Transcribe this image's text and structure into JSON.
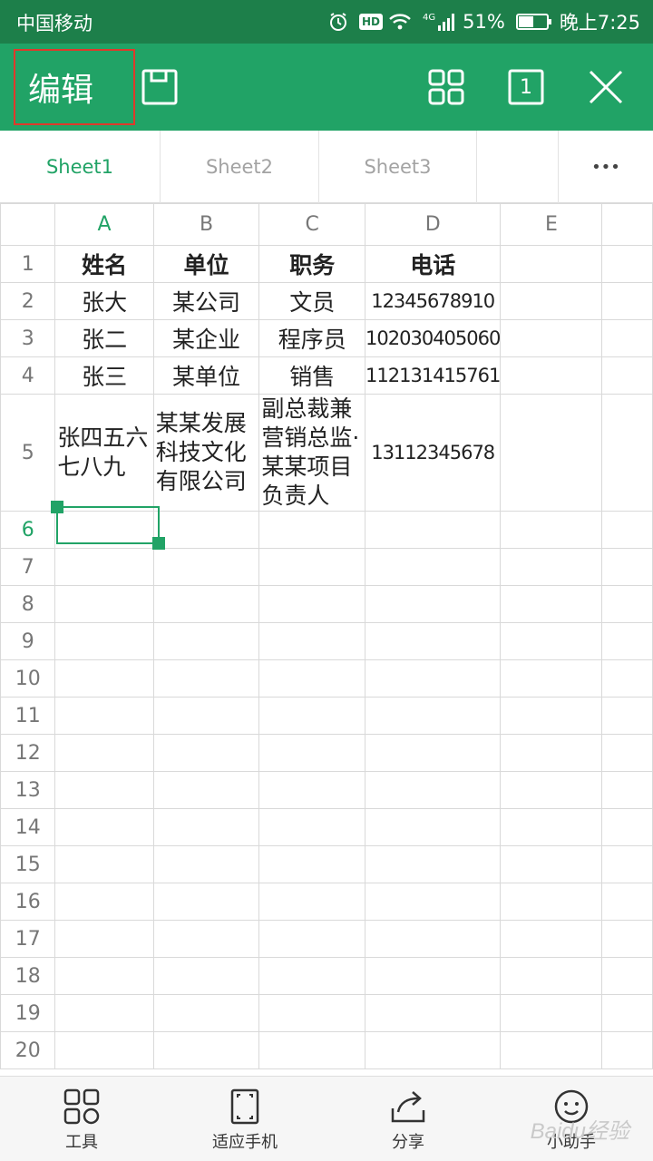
{
  "status_bar": {
    "carrier": "中国移动",
    "network": "4G",
    "battery": "51%",
    "time": "晚上7:25"
  },
  "toolbar": {
    "edit_label": "编辑",
    "page_number": "1"
  },
  "sheet_tabs": [
    {
      "label": "Sheet1",
      "active": true
    },
    {
      "label": "Sheet2",
      "active": false
    },
    {
      "label": "Sheet3",
      "active": false
    }
  ],
  "more_tabs_label": "•••",
  "columns": [
    "A",
    "B",
    "C",
    "D",
    "E"
  ],
  "rows": [
    {
      "num": "1",
      "cells": [
        "姓名",
        "单位",
        "职务",
        "电话",
        ""
      ]
    },
    {
      "num": "2",
      "cells": [
        "张大",
        "某公司",
        "文员",
        "12345678910",
        ""
      ]
    },
    {
      "num": "3",
      "cells": [
        "张二",
        "某企业",
        "程序员",
        "102030405060",
        ""
      ]
    },
    {
      "num": "4",
      "cells": [
        "张三",
        "某单位",
        "销售",
        "112131415761",
        ""
      ]
    },
    {
      "num": "5",
      "cells": [
        "张四五六七八九",
        "某某发展科技文化有限公司",
        "副总裁兼营销总监·某某项目负责人",
        "13112345678",
        ""
      ]
    },
    {
      "num": "6",
      "cells": [
        "",
        "",
        "",
        "",
        ""
      ]
    },
    {
      "num": "7",
      "cells": [
        "",
        "",
        "",
        "",
        ""
      ]
    },
    {
      "num": "8",
      "cells": [
        "",
        "",
        "",
        "",
        ""
      ]
    },
    {
      "num": "9",
      "cells": [
        "",
        "",
        "",
        "",
        ""
      ]
    },
    {
      "num": "10",
      "cells": [
        "",
        "",
        "",
        "",
        ""
      ]
    },
    {
      "num": "11",
      "cells": [
        "",
        "",
        "",
        "",
        ""
      ]
    },
    {
      "num": "12",
      "cells": [
        "",
        "",
        "",
        "",
        ""
      ]
    },
    {
      "num": "13",
      "cells": [
        "",
        "",
        "",
        "",
        ""
      ]
    },
    {
      "num": "14",
      "cells": [
        "",
        "",
        "",
        "",
        ""
      ]
    },
    {
      "num": "15",
      "cells": [
        "",
        "",
        "",
        "",
        ""
      ]
    },
    {
      "num": "16",
      "cells": [
        "",
        "",
        "",
        "",
        ""
      ]
    },
    {
      "num": "17",
      "cells": [
        "",
        "",
        "",
        "",
        ""
      ]
    },
    {
      "num": "18",
      "cells": [
        "",
        "",
        "",
        "",
        ""
      ]
    },
    {
      "num": "19",
      "cells": [
        "",
        "",
        "",
        "",
        ""
      ]
    },
    {
      "num": "20",
      "cells": [
        "",
        "",
        "",
        "",
        ""
      ]
    }
  ],
  "selected_cell": "A6",
  "bottom_bar": [
    {
      "label": "工具",
      "icon": "tools-grid-icon"
    },
    {
      "label": "适应手机",
      "icon": "fit-phone-icon"
    },
    {
      "label": "分享",
      "icon": "share-icon"
    },
    {
      "label": "小助手",
      "icon": "assistant-icon"
    }
  ],
  "watermark": "Baidu经验",
  "colors": {
    "status_bar": "#1d7f4a",
    "toolbar": "#21a366",
    "accent": "#21a366",
    "highlight_box": "#e0392b"
  }
}
